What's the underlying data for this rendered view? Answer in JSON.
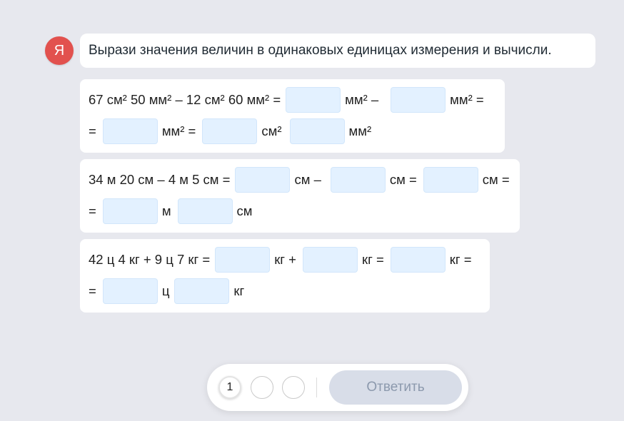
{
  "header": {
    "logo_letter": "Я",
    "instruction": "Вырази значения величин в одинаковых единицах измерения и вычисли."
  },
  "exercises": [
    {
      "line1": {
        "expression": "67 см² 50 мм² – 12 см² 60 мм² =",
        "unit1": "мм² –",
        "unit2": "мм² ="
      },
      "line2": {
        "prefix": "=",
        "unit1": "мм² =",
        "unit2": "см²",
        "unit3": "мм²"
      }
    },
    {
      "line1": {
        "expression": "34 м 20 см – 4 м 5 см =",
        "unit1": "см –",
        "unit2": "см =",
        "unit3": "см ="
      },
      "line2": {
        "prefix": "=",
        "unit1": "м",
        "unit2": "см"
      }
    },
    {
      "line1": {
        "expression": "42 ц 4 кг + 9 ц 7 кг =",
        "unit1": "кг +",
        "unit2": "кг =",
        "unit3": "кг ="
      },
      "line2": {
        "prefix": "=",
        "unit1": "ц",
        "unit2": "кг"
      }
    }
  ],
  "footer": {
    "pages": [
      "1",
      "",
      ""
    ],
    "active_page": "1",
    "answer_label": "Ответить"
  },
  "colors": {
    "background": "#e7e8ee",
    "logo": "#e2514e",
    "input_fill": "#e3f1ff",
    "button_disabled": "#d8dde8",
    "button_text": "#8c99ad"
  }
}
